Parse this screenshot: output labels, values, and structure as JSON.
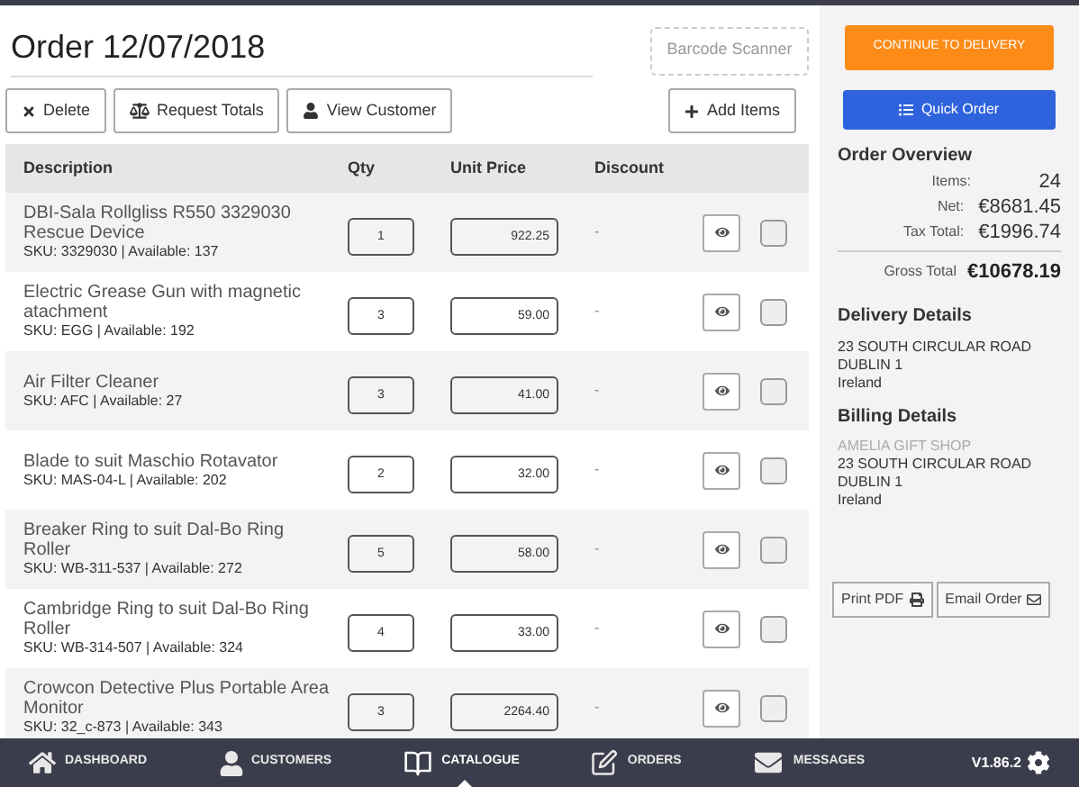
{
  "title": "Order 12/07/2018",
  "barcode_button": "Barcode Scanner",
  "toolbar": [
    {
      "kind": "delete",
      "label": "Delete"
    },
    {
      "kind": "totals",
      "label": "Request Totals"
    },
    {
      "kind": "customer",
      "label": "View Customer"
    }
  ],
  "add_button": "Add Items",
  "table": {
    "columns": [
      "Description",
      "Qty",
      "Unit Price",
      "Discount"
    ],
    "rows": [
      {
        "description": "DBI-Sala Rollgliss R550 3329030 Rescue Device",
        "sku": "SKU: 3329030 | Available: 137",
        "qty": "1",
        "price": "922.25",
        "discount": "-",
        "checked": false
      },
      {
        "description": "Electric Grease Gun with magnetic atachment",
        "sku": "SKU: EGG | Available: 192",
        "qty": "3",
        "price": "59.00",
        "discount": "-",
        "checked": false
      },
      {
        "description": "Air Filter Cleaner",
        "sku": "SKU: AFC | Available: 27",
        "qty": "3",
        "price": "41.00",
        "discount": "-",
        "checked": false
      },
      {
        "description": "Blade to suit Maschio Rotavator",
        "sku": "SKU: MAS-04-L | Available: 202",
        "qty": "2",
        "price": "32.00",
        "discount": "-",
        "checked": false
      },
      {
        "description": "Breaker Ring to suit Dal-Bo Ring Roller",
        "sku": "SKU: WB-311-537 | Available: 272",
        "qty": "5",
        "price": "58.00",
        "discount": "-",
        "checked": false
      },
      {
        "description": "Cambridge Ring to suit Dal-Bo Ring Roller",
        "sku": "SKU: WB-314-507 | Available: 324",
        "qty": "4",
        "price": "33.00",
        "discount": "-",
        "checked": false
      },
      {
        "description": "Crowcon Detective Plus Portable Area Monitor",
        "sku": "SKU: 32_c-873 | Available: 343",
        "qty": "3",
        "price": "2264.40",
        "discount": "-",
        "checked": false
      }
    ]
  },
  "sidebar": {
    "continue_button": "CONTINUE TO DELIVERY",
    "quick_order_button": "Quick Order",
    "overview_title": "Order Overview",
    "overview": [
      {
        "label": "Items:",
        "value": "24"
      },
      {
        "label": "Net:",
        "value": "€8681.45"
      },
      {
        "label": "Tax Total:",
        "value": "€1996.74"
      }
    ],
    "gross": {
      "label": "Gross Total",
      "value": "€10678.19"
    },
    "delivery_title": "Delivery Details",
    "delivery": [
      "23 SOUTH CIRCULAR ROAD",
      "DUBLIN 1",
      "Ireland"
    ],
    "billing_title": "Billing Details",
    "billing_name": "AMELIA GIFT SHOP",
    "billing": [
      "23 SOUTH CIRCULAR ROAD",
      "DUBLIN 1",
      "Ireland"
    ],
    "actions": [
      {
        "kind": "print",
        "label": "Print PDF"
      },
      {
        "kind": "email",
        "label": "Email Order"
      }
    ]
  },
  "nav": [
    {
      "kind": "home",
      "label": "DASHBOARD",
      "selected": false
    },
    {
      "kind": "user",
      "label": "CUSTOMERS",
      "selected": false
    },
    {
      "kind": "book",
      "label": "CATALOGUE",
      "selected": true
    },
    {
      "kind": "edit",
      "label": "ORDERS",
      "selected": false
    },
    {
      "kind": "mail",
      "label": "MESSAGES",
      "selected": false
    }
  ],
  "version": "V1.86.2"
}
